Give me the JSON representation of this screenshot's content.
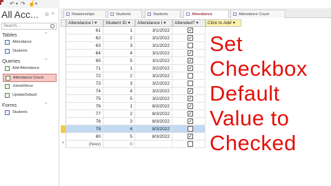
{
  "quick_access": {
    "items": [
      "save-icon",
      "undo-icon",
      "redo-icon",
      "touch-mode-icon",
      "customize-icon"
    ]
  },
  "nav": {
    "title": "All Acc...",
    "search_placeholder": "Search...",
    "groups": [
      {
        "label": "Tables",
        "items": [
          "Attendance",
          "Students"
        ]
      },
      {
        "label": "Queries",
        "items": [
          "Add Attendance",
          "Attendance Count",
          "JoinedSince",
          "UpdateDefault"
        ]
      },
      {
        "label": "Forms",
        "items": [
          "Students"
        ]
      }
    ],
    "selected": "Attendance Count"
  },
  "tabs": [
    {
      "label": "Relationships",
      "active": false
    },
    {
      "label": "Students",
      "active": false
    },
    {
      "label": "Students",
      "active": false
    },
    {
      "label": "Attendance",
      "active": true
    },
    {
      "label": "Attendance Count",
      "active": false
    }
  ],
  "table": {
    "columns": [
      "Attendance I",
      "Student ID",
      "Attendance I",
      "Attended?",
      "Click to Add"
    ],
    "rows": [
      {
        "id": "61",
        "student": "1",
        "date": "3/1/2022",
        "attended": true
      },
      {
        "id": "62",
        "student": "2",
        "date": "3/1/2022",
        "attended": true
      },
      {
        "id": "63",
        "student": "3",
        "date": "3/1/2022",
        "attended": false
      },
      {
        "id": "64",
        "student": "4",
        "date": "3/1/2022",
        "attended": true
      },
      {
        "id": "65",
        "student": "5",
        "date": "3/1/2022",
        "attended": true
      },
      {
        "id": "71",
        "student": "1",
        "date": "3/2/2022",
        "attended": true
      },
      {
        "id": "72",
        "student": "2",
        "date": "3/2/2022",
        "attended": false
      },
      {
        "id": "73",
        "student": "3",
        "date": "3/2/2022",
        "attended": false
      },
      {
        "id": "74",
        "student": "4",
        "date": "3/2/2022",
        "attended": true
      },
      {
        "id": "75",
        "student": "5",
        "date": "3/2/2022",
        "attended": true
      },
      {
        "id": "76",
        "student": "1",
        "date": "8/3/2022",
        "attended": true
      },
      {
        "id": "77",
        "student": "2",
        "date": "8/3/2022",
        "attended": true
      },
      {
        "id": "78",
        "student": "3",
        "date": "8/3/2022",
        "attended": true
      },
      {
        "id": "79",
        "student": "4",
        "date": "8/3/2022",
        "attended": false
      },
      {
        "id": "80",
        "student": "5",
        "date": "8/3/2022",
        "attended": true
      }
    ],
    "selected_row": "79",
    "new_row": {
      "id": "(New)",
      "student": "0"
    }
  },
  "overlay": {
    "lines": [
      "Set",
      "Checkbox",
      "Default",
      "Value to",
      "Checked"
    ]
  },
  "colors": {
    "accent": "#a4373a",
    "overlay_text": "#e3110b",
    "add_column": "#fdf3a8",
    "selected_row": "#c2d9f2",
    "nav_selected": "#f8c8c6"
  }
}
